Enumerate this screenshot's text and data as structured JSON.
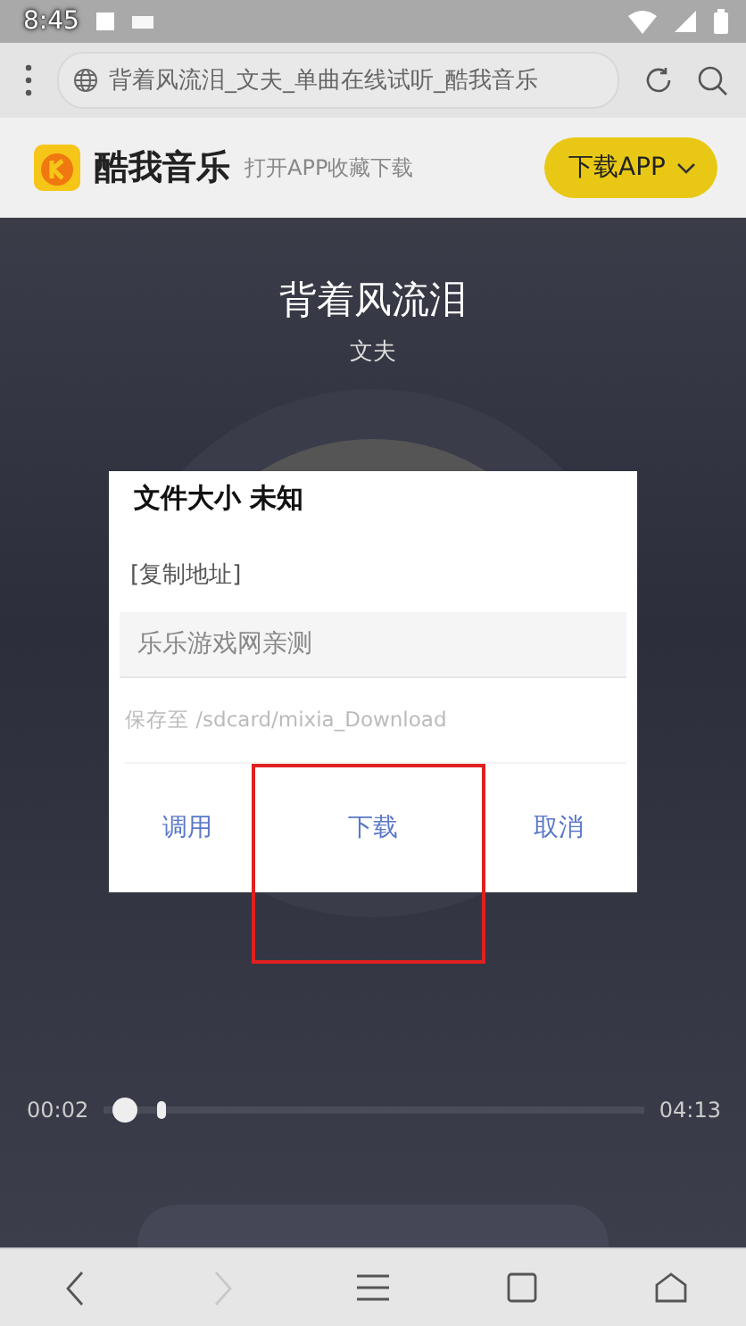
{
  "status_bar": {
    "time": "8:45"
  },
  "browser_bar": {
    "address": "背着风流泪_文夫_单曲在线试听_酷我音乐"
  },
  "app_header": {
    "brand": "酷我音乐",
    "tagline": "打开APP收藏下载",
    "download_button": "下载APP"
  },
  "song": {
    "title": "背着风流泪",
    "artist": "文夫"
  },
  "dialog": {
    "title": "文件大小 未知",
    "copy_link": "[复制地址]",
    "name_field": {
      "value": "乐乐游戏网亲测"
    },
    "save_path": "保存至 /sdcard/mixia_Download",
    "buttons": [
      {
        "label": "调用",
        "selected": false
      },
      {
        "label": "下载",
        "selected": true
      },
      {
        "label": "取消",
        "selected": false
      }
    ]
  },
  "player": {
    "elapsed": "00:02",
    "duration": "04:13",
    "level": 0.02
  },
  "nav_bar": {
    "items": [
      {
        "kind": "back",
        "disabled": false
      },
      {
        "kind": "forward",
        "disabled": true
      },
      {
        "kind": "menu",
        "disabled": false
      },
      {
        "kind": "tabs",
        "disabled": false
      },
      {
        "kind": "home",
        "disabled": false
      }
    ]
  }
}
